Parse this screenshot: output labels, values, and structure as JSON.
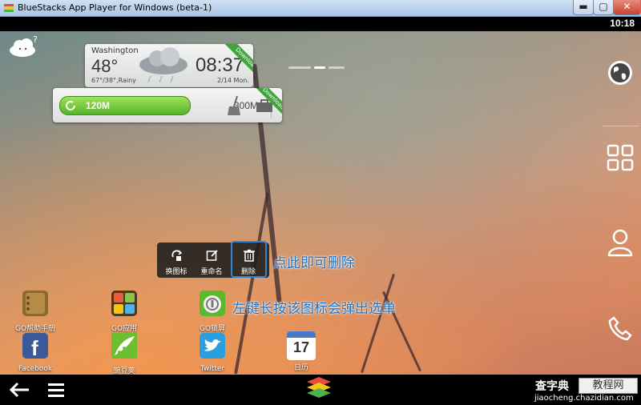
{
  "window": {
    "title": "BlueStacks App Player for Windows (beta-1)",
    "min_label": "▬",
    "max_label": "▢",
    "close_label": "✕"
  },
  "status": {
    "time": "10:18"
  },
  "weather": {
    "city": "Washington",
    "temp": "48°",
    "range": "67°/38°,Rainy",
    "time": "08:37",
    "date": "2/14 Mon.",
    "ribbon": "Download"
  },
  "memory": {
    "used": "120M",
    "total": "300M",
    "ribbon": "Download"
  },
  "context_menu": {
    "items": [
      {
        "label": "换图标",
        "icon": "swap-icon"
      },
      {
        "label": "重命名",
        "icon": "edit-icon"
      },
      {
        "label": "删除",
        "icon": "trash-icon"
      }
    ]
  },
  "annotations": {
    "delete_hint": "点此即可删除",
    "longpress_hint": "左键长按该图标会弹出选单"
  },
  "apps": [
    {
      "label": "GO帮助手册",
      "icon": "go-help-icon"
    },
    {
      "label": "GO应用",
      "icon": "go-apps-icon"
    },
    {
      "label": "GO锁屏",
      "icon": "go-locker-icon"
    },
    {
      "label": "Facebook",
      "icon": "facebook-icon"
    },
    {
      "label": "豌豆荚",
      "icon": "wandoujia-icon"
    },
    {
      "label": "Twitter",
      "icon": "twitter-icon"
    },
    {
      "label": "日历",
      "icon": "calendar-icon",
      "day": "17"
    }
  ],
  "watermark": {
    "brand": "查字典",
    "box": "教程网",
    "url": "jiaocheng.chazidian.com"
  },
  "colors": {
    "accent_blue": "#2d86d6",
    "download_green": "#3ea53a",
    "memory_green": "#57b22a"
  }
}
